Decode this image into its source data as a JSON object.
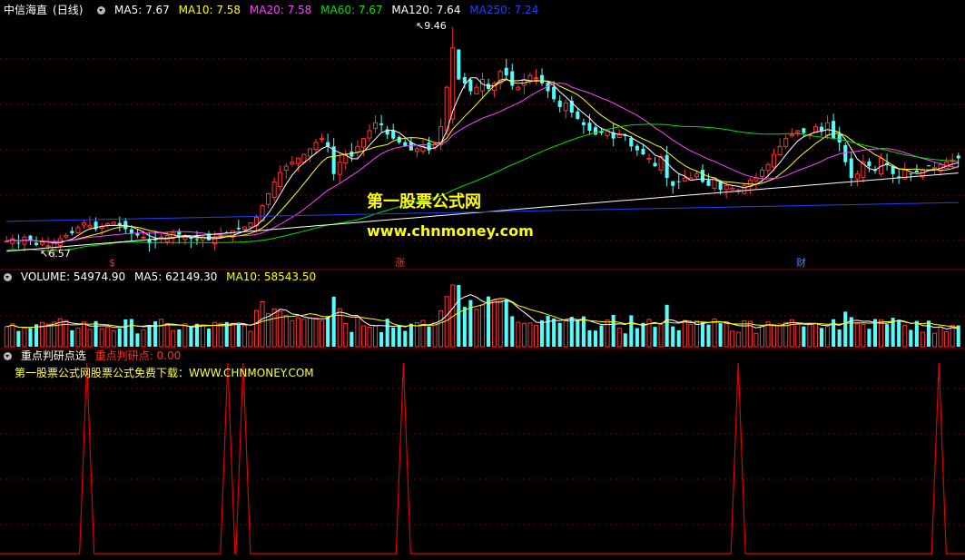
{
  "stock": {
    "name": "中信海直",
    "period": "(日线)"
  },
  "ma_legend": [
    {
      "label": "MA5: 7.67",
      "color": "#ffffff"
    },
    {
      "label": "MA10: 7.58",
      "color": "#ffff00"
    },
    {
      "label": "MA20: 7.58",
      "color": "#ff40ff"
    },
    {
      "label": "MA60: 7.67",
      "color": "#00e000"
    },
    {
      "label": "MA120: 7.64",
      "color": "#ffffff"
    },
    {
      "label": "MA250: 7.24",
      "color": "#2040ff"
    }
  ],
  "annotations": {
    "high": "9.46",
    "low": "6.57"
  },
  "markers": {
    "m1": "$",
    "m2": "涨",
    "m3": "财"
  },
  "volume_legend": {
    "title": "VOLUME: 54974.90",
    "ma5": "MA5: 62149.30",
    "ma10": "MA10: 58543.50"
  },
  "indicator": {
    "name": "重点判研点选",
    "value_label": "重点判研点: 0.00",
    "promo": "第一股票公式网股票公式免费下载：WWW.CHNMONEY.COM"
  },
  "watermark": {
    "line1": "第一股票公式网",
    "line2": "www.chnmoney.com"
  },
  "colors": {
    "up": "#ff3232",
    "down": "#54fcfc",
    "bg": "#000000",
    "grid": "#800000",
    "ma5": "#ffffff",
    "ma10": "#ffff00",
    "ma20": "#ff40ff",
    "ma60": "#00e000",
    "ma120": "#ffffff",
    "ma250": "#2040ff",
    "signal": "#e00000"
  },
  "chart_data": {
    "type": "candlestick",
    "y_range": [
      6.4,
      9.6
    ],
    "closes": [
      6.75,
      6.78,
      6.72,
      6.8,
      6.76,
      6.7,
      6.74,
      6.69,
      6.73,
      6.78,
      6.82,
      6.85,
      6.92,
      6.98,
      6.95,
      6.9,
      6.93,
      6.97,
      6.99,
      6.95,
      6.9,
      6.85,
      6.82,
      6.8,
      6.72,
      6.76,
      6.8,
      6.82,
      6.85,
      6.83,
      6.8,
      6.78,
      6.77,
      6.8,
      6.76,
      6.79,
      6.82,
      6.85,
      6.88,
      6.9,
      6.93,
      6.98,
      7.05,
      7.2,
      7.35,
      7.5,
      7.62,
      7.7,
      7.75,
      7.8,
      7.85,
      7.92,
      8.0,
      8.05,
      7.95,
      7.6,
      7.75,
      7.85,
      7.82,
      7.95,
      8.05,
      8.15,
      8.25,
      8.22,
      8.1,
      8.05,
      8.0,
      7.95,
      7.9,
      7.92,
      7.95,
      7.9,
      7.98,
      8.2,
      8.7,
      9.2,
      8.8,
      8.75,
      8.65,
      8.7,
      8.8,
      8.68,
      8.75,
      8.9,
      8.85,
      8.72,
      8.7,
      8.8,
      8.85,
      8.82,
      8.75,
      8.65,
      8.55,
      8.45,
      8.5,
      8.38,
      8.3,
      8.22,
      8.15,
      8.1,
      8.12,
      8.15,
      8.05,
      8.1,
      8.08,
      7.95,
      7.9,
      7.85,
      7.8,
      7.7,
      7.82,
      7.55,
      7.45,
      7.5,
      7.55,
      7.55,
      7.6,
      7.5,
      7.45,
      7.55,
      7.4,
      7.45,
      7.42,
      7.4,
      7.45,
      7.52,
      7.55,
      7.65,
      7.72,
      7.85,
      7.95,
      8.05,
      8.1,
      8.15,
      8.12,
      8.1,
      8.2,
      8.15,
      8.25,
      8.05,
      8.0,
      7.75,
      7.55,
      7.6,
      7.75,
      7.7,
      7.65,
      7.8,
      7.72,
      7.6,
      7.55,
      7.65,
      7.6,
      7.62,
      7.65,
      7.7,
      7.68,
      7.72,
      7.75,
      7.78,
      7.8
    ],
    "signal_positions": [
      0.09,
      0.236,
      0.252,
      0.418,
      0.765,
      0.973
    ],
    "volume_ma5": 62149.3,
    "volume_ma10": 58543.5,
    "last_volume": 54974.9
  }
}
